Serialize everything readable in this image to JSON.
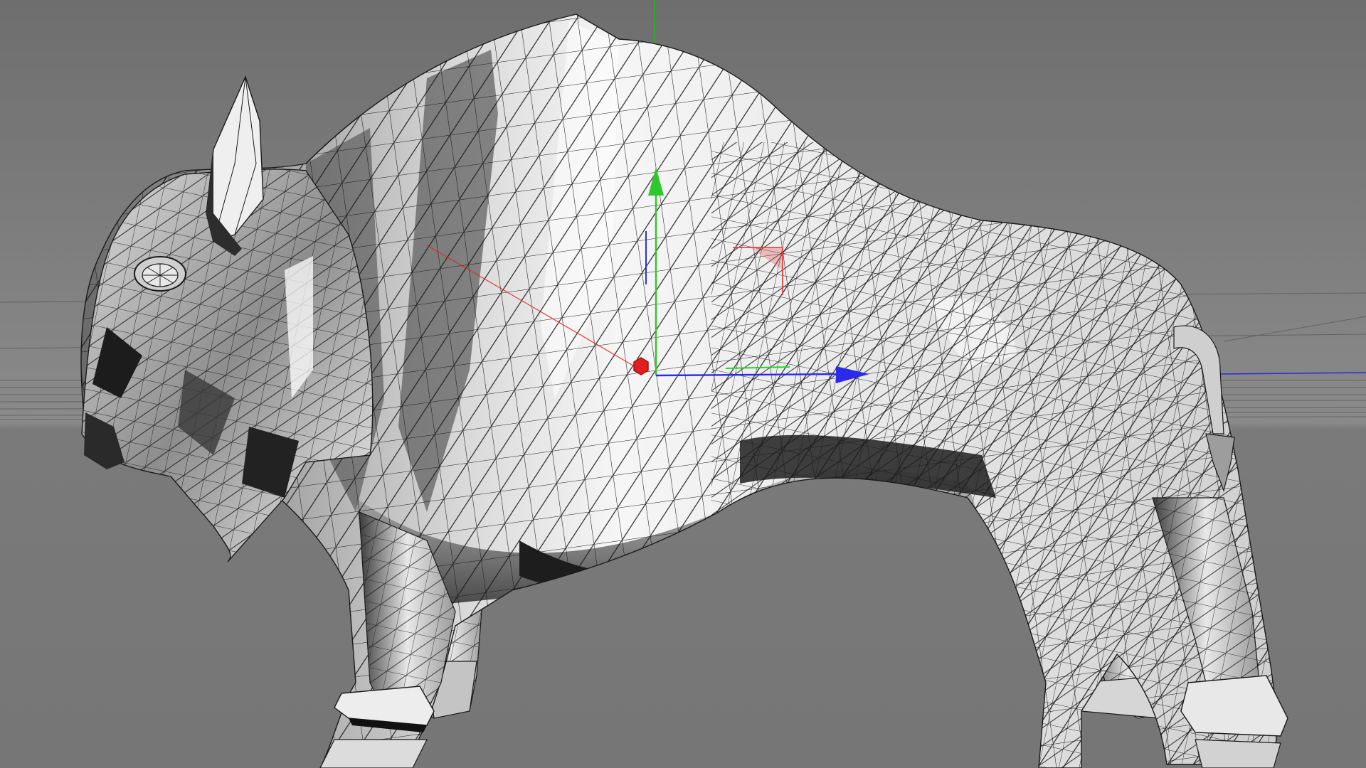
{
  "viewport": {
    "name": "3d-viewport",
    "shading": "gouraud-shaded-with-wireframe-lines",
    "model": "low-poly-bison-mesh"
  },
  "colors": {
    "background_top": "#6f6f6f",
    "background_bottom": "#828282",
    "horizon_line": "#555555",
    "mesh_light": "#f4f4f4",
    "mesh_mid": "#bdbdbd",
    "mesh_dark": "#3a3a3a",
    "mesh_wire": "#1a1a1a",
    "axis_x": "#e02020",
    "axis_y": "#27c427",
    "axis_z": "#2a2ae8",
    "world_axis_green": "#1fb81f",
    "world_axis_blue": "#2828e0"
  },
  "gizmo": {
    "type": "move-tool-gizmo",
    "handles": [
      "x-axis-handle",
      "y-axis-handle",
      "z-axis-handle",
      "pivot-point"
    ]
  }
}
